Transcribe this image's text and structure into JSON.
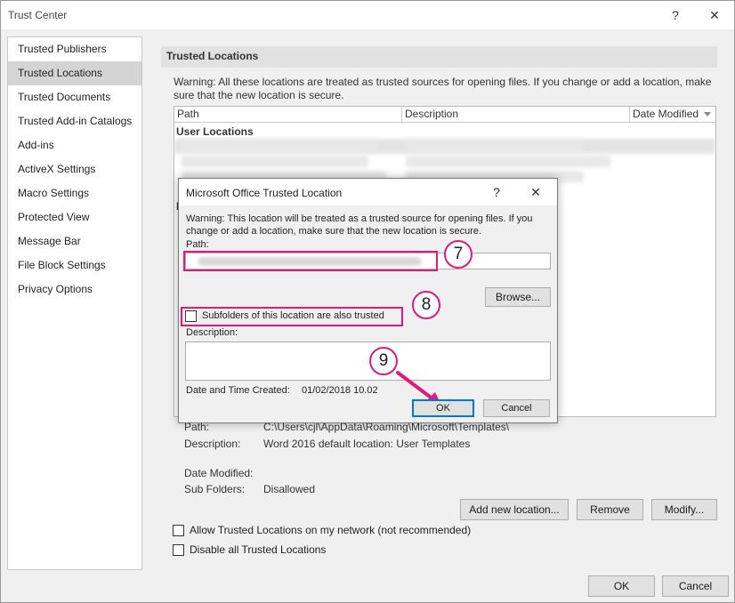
{
  "window": {
    "title": "Trust Center",
    "help_glyph": "?",
    "close_glyph": "✕"
  },
  "sidebar": {
    "items": [
      {
        "label": "Trusted Publishers"
      },
      {
        "label": "Trusted Locations"
      },
      {
        "label": "Trusted Documents"
      },
      {
        "label": "Trusted Add-in Catalogs"
      },
      {
        "label": "Add-ins"
      },
      {
        "label": "ActiveX Settings"
      },
      {
        "label": "Macro Settings"
      },
      {
        "label": "Protected View"
      },
      {
        "label": "Message Bar"
      },
      {
        "label": "File Block Settings"
      },
      {
        "label": "Privacy Options"
      }
    ],
    "active_index": 1
  },
  "main": {
    "section_title": "Trusted Locations",
    "warning": "Warning: All these locations are treated as trusted sources for opening files.  If you change or add a location, make sure that the new location is secure.",
    "table": {
      "columns": [
        "Path",
        "Description",
        "Date Modified"
      ],
      "group_user": "User Locations",
      "group_policy": "P"
    },
    "details": {
      "path_label": "Path:",
      "path_value": "C:\\Users\\cjl\\AppData\\Roaming\\Microsoft\\Templates\\",
      "description_label": "Description:",
      "description_value": "Word 2016 default location: User Templates",
      "date_label": "Date Modified:",
      "subfolders_label": "Sub Folders:",
      "subfolders_value": "Disallowed"
    },
    "buttons": {
      "add": "Add new location...",
      "remove": "Remove",
      "modify": "Modify..."
    },
    "checkboxes": {
      "allow_network": "Allow Trusted Locations on my network (not recommended)",
      "disable_all": "Disable all Trusted Locations"
    }
  },
  "footer": {
    "ok": "OK",
    "cancel": "Cancel"
  },
  "dialog": {
    "title": "Microsoft Office Trusted Location",
    "help_glyph": "?",
    "close_glyph": "✕",
    "warning": "Warning: This location will be treated as a trusted source for opening files. If you change or add a location, make sure that the new location is secure.",
    "path_label": "Path:",
    "browse": "Browse...",
    "subfolders_label": "Subfolders of this location are also trusted",
    "description_label": "Description:",
    "date_label": "Date and Time Created:",
    "date_value": "01/02/2018 10.02",
    "ok": "OK",
    "cancel": "Cancel"
  },
  "annotations": {
    "step7": "7",
    "step8": "8",
    "step9": "9"
  },
  "colors": {
    "highlight": "#e0197a",
    "accent": "#0078d7",
    "selected_nav": "#d4d4d4"
  }
}
